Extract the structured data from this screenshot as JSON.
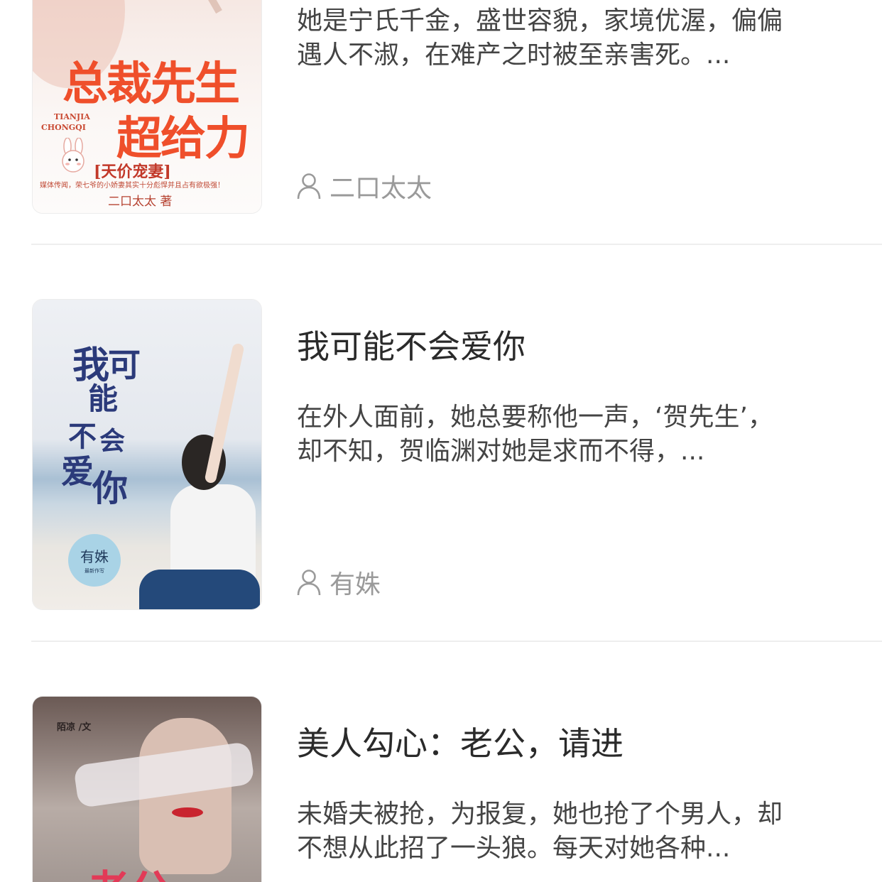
{
  "books": [
    {
      "title": "",
      "desc_line1": "她是宁氏千金，盛世容貌，家境优渥，偏偏",
      "desc_line2": "遇人不淑，在难产之时被至亲害死。...",
      "author": "二口太太",
      "cover": {
        "main_title_1": "总裁先生",
        "main_title_2": "超给力",
        "subtitle": "[天价宠妻]",
        "pinyin_1": "TIANJIA",
        "pinyin_2": "CHONGQI",
        "tagline": "媒体传闻，荣七爷的小娇妻其实十分彪悍并且占有欲极强！",
        "author_line": "二口太太 著"
      }
    },
    {
      "title": "我可能不会爱你",
      "desc_line1": "在外人面前，她总要称他一声，‘贺先生’，",
      "desc_line2": "却不知，贺临渊对她是求而不得，...",
      "author": "有姝",
      "cover": {
        "title_chars": [
          "我",
          "可",
          "能",
          "不",
          "会",
          "爱",
          "你"
        ],
        "badge_name": "有姝",
        "badge_sub": "最新作写"
      }
    },
    {
      "title": "美人勾心：老公，请进",
      "desc_line1": "未婚夫被抢，为报复，她也抢了个男人，却",
      "desc_line2": "不想从此招了一头狼。每天对她各种...",
      "author": "",
      "cover": {
        "byline": "陌凉 /文",
        "partial_title": "老公"
      }
    }
  ],
  "colors": {
    "title": "#2a2a2a",
    "desc": "#444444",
    "author": "#9a9a9a",
    "divider": "#eeeeee",
    "cover1_title": "#ef4f2b",
    "cover2_title": "#2b3a7a"
  },
  "icons": {
    "author": "person-outline-icon"
  }
}
